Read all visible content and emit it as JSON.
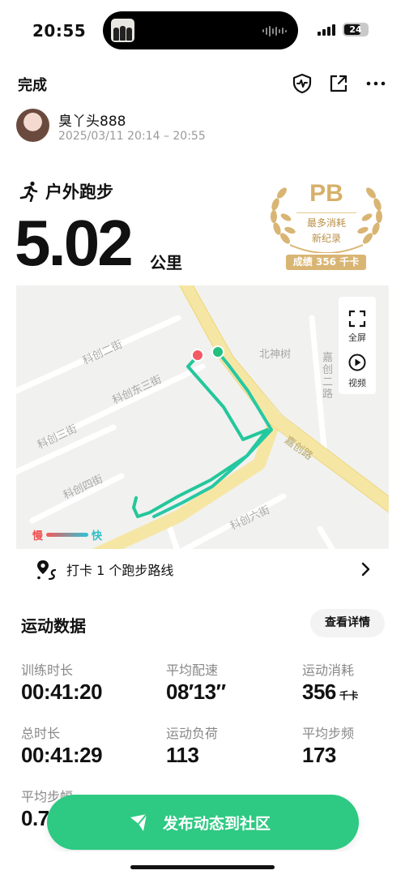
{
  "status_bar": {
    "time": "20:55",
    "battery": "24"
  },
  "header": {
    "done_label": "完成"
  },
  "user": {
    "name": "臭丫头888",
    "datetime": "2025/03/11 20:14 – 20:55"
  },
  "activity": {
    "type": "户外跑步",
    "distance": "5.02",
    "unit": "公里"
  },
  "pb_badge": {
    "title": "PB",
    "line1": "最多消耗",
    "line2": "新纪录",
    "result": "成绩 356 千卡"
  },
  "map": {
    "labels": [
      "科创二街",
      "科创东三街",
      "科创三街",
      "科创四街",
      "北神树",
      "嘉创二路",
      "嘉创路",
      "科创六街"
    ],
    "controls": {
      "fullscreen": "全屏",
      "video": "视频"
    },
    "legend": {
      "slow": "慢",
      "fast": "快"
    },
    "route_link": "打卡 1 个跑步路线"
  },
  "stats": {
    "title": "运动数据",
    "details_button": "查看详情",
    "items": [
      {
        "label": "训练时长",
        "value": "00:41:20"
      },
      {
        "label": "平均配速",
        "value": "08′13″"
      },
      {
        "label": "运动消耗",
        "value": "356",
        "unit": "千卡"
      },
      {
        "label": "总时长",
        "value": "00:41:29"
      },
      {
        "label": "运动负荷",
        "value": "113"
      },
      {
        "label": "平均步频",
        "value": "173"
      },
      {
        "label": "平均步幅",
        "value": "0.7"
      }
    ]
  },
  "publish": {
    "label": "发布动态到社区"
  },
  "colors": {
    "accent": "#2ec982",
    "pb_gold": "#d6b06a",
    "road": "#f6e6a4"
  }
}
